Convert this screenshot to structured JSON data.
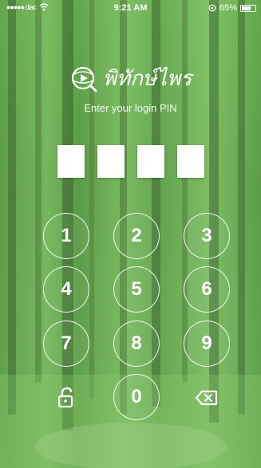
{
  "status": {
    "signal": "●●●●● dtac",
    "time": "9:21 AM",
    "battery": "65%"
  },
  "app": {
    "name": "พิทักษ์ไพร",
    "subtitle": "Enter your login PIN"
  },
  "keypad": {
    "k1": "1",
    "k2": "2",
    "k3": "3",
    "k4": "4",
    "k5": "5",
    "k6": "6",
    "k7": "7",
    "k8": "8",
    "k9": "9",
    "k0": "0"
  },
  "icons": {
    "left": "unlock-icon",
    "right": "backspace-icon",
    "logo": "globe-play-icon"
  }
}
